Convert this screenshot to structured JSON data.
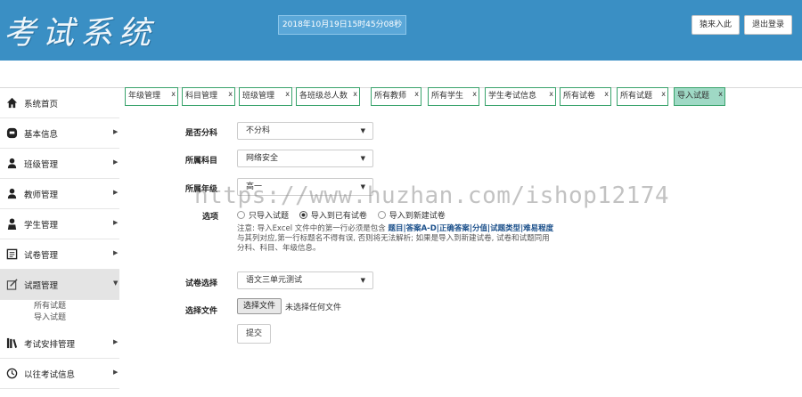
{
  "header": {
    "logo": "考试系统",
    "datetime": "2018年10月19日15时45分08秒",
    "buttons": [
      "猿来入此",
      "退出登录"
    ]
  },
  "sidebar": {
    "items": [
      {
        "label": "系统首页",
        "icon": "home-icon",
        "arrow": ""
      },
      {
        "label": "基本信息",
        "icon": "info-icon",
        "arrow": "▶"
      },
      {
        "label": "班级管理",
        "icon": "class-icon",
        "arrow": "▶"
      },
      {
        "label": "教师管理",
        "icon": "teacher-icon",
        "arrow": "▶"
      },
      {
        "label": "学生管理",
        "icon": "student-icon",
        "arrow": "▶"
      },
      {
        "label": "试卷管理",
        "icon": "paper-icon",
        "arrow": "▶"
      },
      {
        "label": "试题管理",
        "icon": "question-icon",
        "arrow": "▼"
      },
      {
        "label": "考试安排管理",
        "icon": "books-icon",
        "arrow": "▶"
      },
      {
        "label": "以往考试信息",
        "icon": "clock-icon",
        "arrow": "▶"
      }
    ],
    "subitems": [
      "所有试题",
      "导入试题"
    ]
  },
  "tabs": [
    {
      "label": "年级管理",
      "close": "x"
    },
    {
      "label": "科目管理",
      "close": "x"
    },
    {
      "label": "班级管理",
      "close": "x"
    },
    {
      "label": "各班级总人数",
      "close": "x"
    },
    {
      "label": "所有教师",
      "close": "x"
    },
    {
      "label": "所有学生",
      "close": "x"
    },
    {
      "label": "学生考试信息",
      "close": "x"
    },
    {
      "label": "所有试卷",
      "close": "x"
    },
    {
      "label": "所有试题",
      "close": "x"
    },
    {
      "label": "导入试题",
      "close": "x"
    }
  ],
  "form": {
    "score_label": "是否分科",
    "score_value": "不分科",
    "subject_label": "所属科目",
    "subject_value": "网络安全",
    "grade_label": "所属年级",
    "grade_value": "高一",
    "options_label": "选项",
    "radio_options": [
      "只导入试题",
      "导入到已有试卷",
      "导入到新建试卷"
    ],
    "selected_option": "导入到已有试卷",
    "note_prefix": "注意: 导入Excel 文件中的第一行必须是包含 ",
    "note_highlight": "题目|答案A-D|正确答案|分值|试题类型|难易程度",
    "note_suffix": " 与其列对应,第一行标题名不得有误, 否则将无法解析; 如果是导入到新建试卷, 试卷和试题同用 分科、科目、年级信息。",
    "paper_label": "试卷选择",
    "paper_value": "语文三单元测试",
    "file_label": "选择文件",
    "file_button": "选择文件",
    "file_status": "未选择任何文件",
    "submit_label": "提交"
  },
  "watermark": "https://www.huzhan.com/ishop12174",
  "colors": {
    "header": "#3a8fc4",
    "tab_border": "#39a36c",
    "tab_active": "#9fd9c5",
    "highlight": "#1a4f8a"
  }
}
